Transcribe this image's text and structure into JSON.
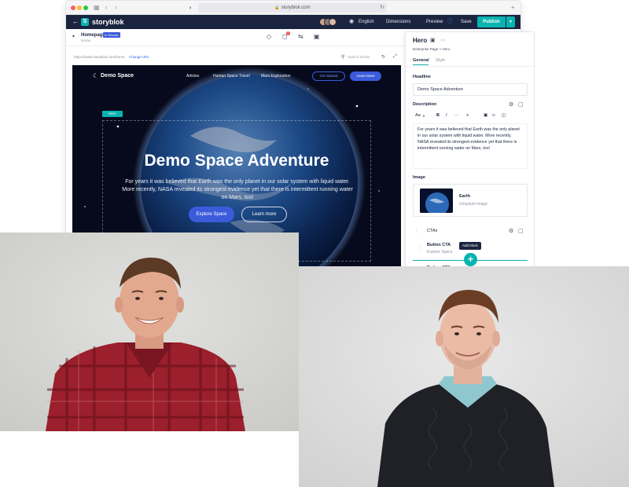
{
  "browser": {
    "url": "storyblok.com"
  },
  "appbar": {
    "brand": "storyblok",
    "language": "English",
    "dimensions": "Dimensions",
    "preview": "Preview",
    "save": "Save",
    "publish": "Publish"
  },
  "story": {
    "name": "Homepage",
    "slug": "Home",
    "badge": "In Review"
  },
  "preview_bar": {
    "url": "https://www.storyblok.com/home",
    "change_url": "Change URL",
    "search_placeholder": "Search blocks"
  },
  "site": {
    "brand": "Demo Space",
    "nav": [
      "Articles",
      "Human Space Travel",
      "Mars Exploration"
    ],
    "get_started": "Get Started",
    "learn_more_top": "Learn More",
    "block_tag": "Hero",
    "title": "Demo Space Adventure",
    "description": "For years it was believed that Earth was the only planet in our solar system with liquid water. More recently, NASA revealed its strongest evidence yet that there is intermittent running water on Mars, too!",
    "explore": "Explore Space",
    "learn_more": "Learn more"
  },
  "panel": {
    "title": "Hero",
    "breadcrumb": "Enterprise Page  >  Hero",
    "tabs": [
      "General",
      "Style"
    ],
    "headline_label": "Headline",
    "headline_value": "Demo Space Adventure",
    "description_label": "Description",
    "toolbar": {
      "font": "Aa",
      "bold": "B",
      "italic": "I",
      "more": "···"
    },
    "description_value": "For years it was believed that Earth was the only planet in our solar system with liquid water. More recently, NASA revealed its strongest evidence yet that there is intermittent running water on Mars, too!",
    "image_label": "Image",
    "asset_name": "Earth",
    "asset_source": "Unsplash image",
    "ctas_label": "CTAs",
    "button_cta": "Button CTA",
    "button_cta_sub": "Explore Space",
    "add_block_tip": "Add block",
    "button_cta_next": "Button CTA"
  },
  "colors": {
    "brand_teal": "#09b3af",
    "accent_blue": "#3b5bdb",
    "navy": "#1b243f"
  }
}
